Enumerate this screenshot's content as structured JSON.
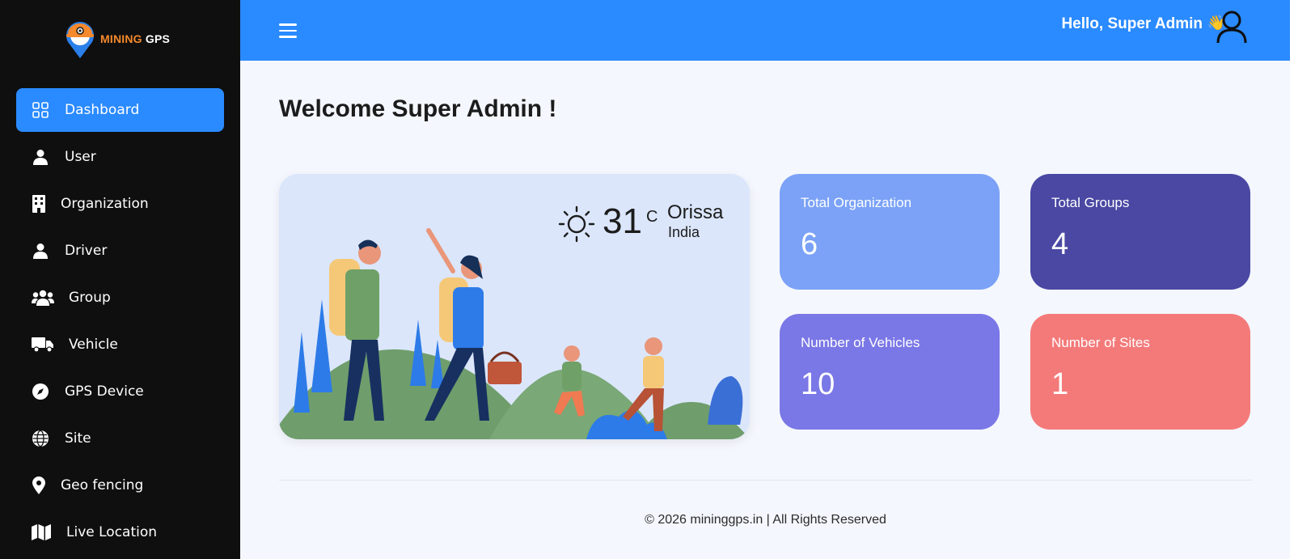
{
  "brand": {
    "name_part1": "MINING",
    "name_part2": " GPS"
  },
  "sidebar": {
    "items": [
      {
        "label": "Dashboard",
        "icon": "grid-icon",
        "active": true
      },
      {
        "label": "User",
        "icon": "user-icon"
      },
      {
        "label": "Organization",
        "icon": "building-icon"
      },
      {
        "label": "Driver",
        "icon": "driver-icon"
      },
      {
        "label": "Group",
        "icon": "users-group-icon"
      },
      {
        "label": "Vehicle",
        "icon": "truck-icon"
      },
      {
        "label": "GPS Device",
        "icon": "compass-icon"
      },
      {
        "label": "Site",
        "icon": "globe-icon"
      },
      {
        "label": "Geo fencing",
        "icon": "map-pin-icon"
      },
      {
        "label": "Live Location",
        "icon": "map-icon"
      }
    ]
  },
  "header": {
    "greeting": "Hello, Super Admin",
    "wave": "👋"
  },
  "main": {
    "title": "Welcome Super Admin !",
    "weather": {
      "temperature": "31",
      "unit": "C",
      "city": "Orissa",
      "country": "India"
    },
    "stats": [
      {
        "label": "Total Organization",
        "value": "6",
        "color": "#7ba2f7"
      },
      {
        "label": "Total Groups",
        "value": "4",
        "color": "#4a48a3"
      },
      {
        "label": "Number of Vehicles",
        "value": "10",
        "color": "#7a77e6"
      },
      {
        "label": "Number of Sites",
        "value": "1",
        "color": "#f47a7a"
      }
    ]
  },
  "footer": {
    "text": "© 2026 mininggps.in | All Rights Reserved"
  },
  "colors": {
    "sidebar_bg": "#0f0f0f",
    "accent": "#2a8aff",
    "page_bg": "#f4f7fd"
  }
}
